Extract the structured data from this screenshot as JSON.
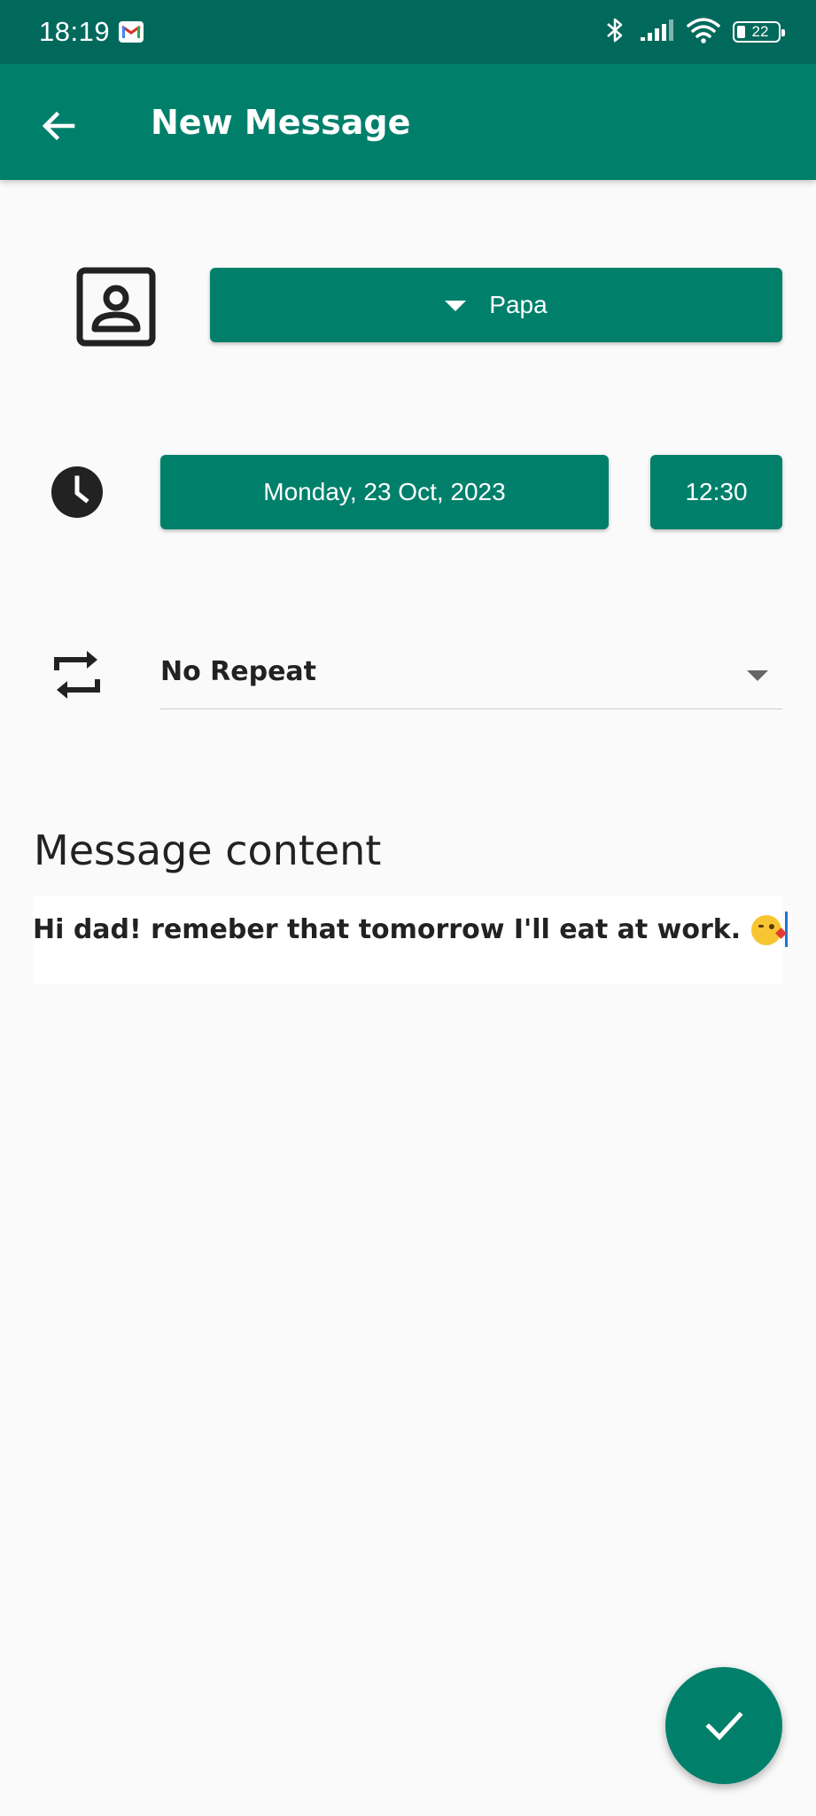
{
  "status_bar": {
    "time": "18:19",
    "battery_level": "22",
    "icons": [
      "gmail-icon",
      "bluetooth-icon",
      "signal-icon",
      "wifi-icon",
      "battery-icon"
    ]
  },
  "app_bar": {
    "title": "New Message",
    "back_icon": "arrow-left-icon",
    "color": "#00806b"
  },
  "form": {
    "contact": {
      "icon": "contact-icon",
      "selected_value": "Papa"
    },
    "schedule": {
      "icon": "clock-icon",
      "date": "Monday, 23 Oct, 2023",
      "time": "12:30"
    },
    "repeat": {
      "icon": "repeat-icon",
      "selected_value": "No Repeat"
    },
    "message": {
      "heading": "Message content",
      "text": "Hi dad! remeber that tomorrow I'll eat at work.",
      "emoji": "kissing-face-emoji"
    }
  },
  "fab": {
    "icon": "check-icon",
    "color": "#00806b"
  },
  "colors": {
    "status_bar": "#00695c",
    "primary": "#00806b",
    "background": "#fafafa",
    "cursor": "#1976d2"
  }
}
